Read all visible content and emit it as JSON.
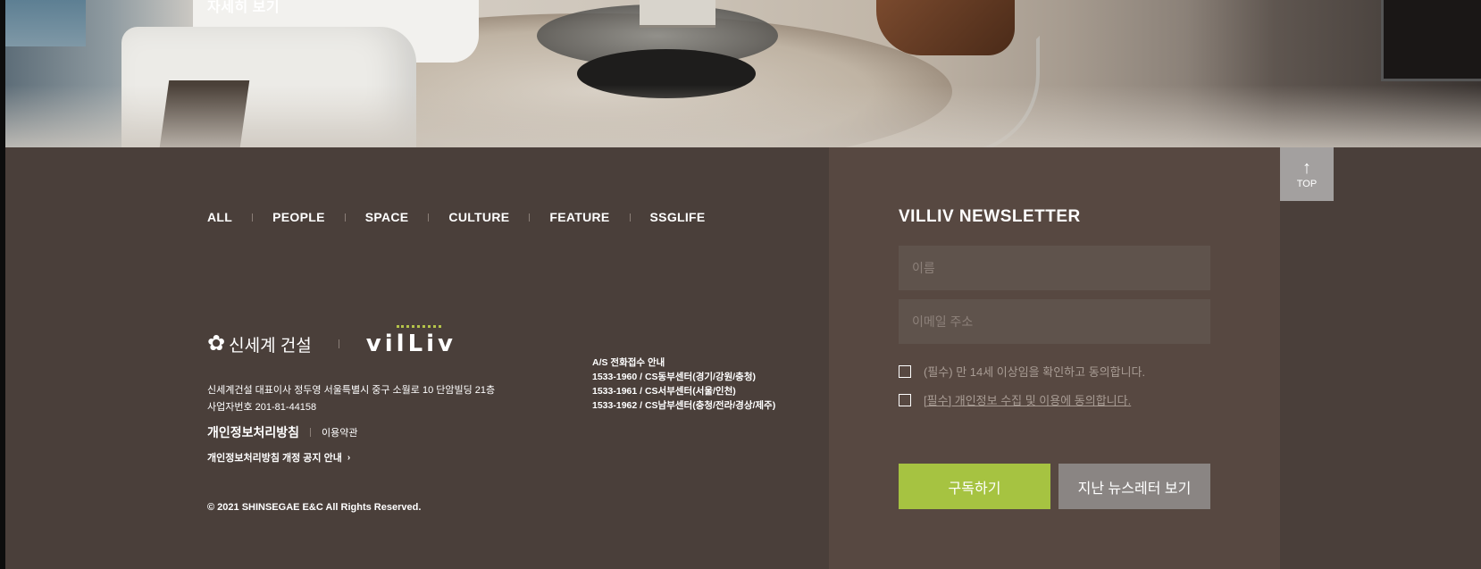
{
  "hero": {
    "link_text": "자세히 보기"
  },
  "nav": [
    "ALL",
    "PEOPLE",
    "SPACE",
    "CULTURE",
    "FEATURE",
    "SSGLIFE"
  ],
  "logos": {
    "ssg": "신세계 건설",
    "villiv": "vilLiv"
  },
  "company": {
    "address": "신세계건설 대표이사 정두영 서울특별시 중구 소월로 10 단암빌딩 21층",
    "biz_no": "사업자번호 201-81-44158"
  },
  "links": {
    "privacy": "개인정보처리방침",
    "terms": "이용약관",
    "notice": "개인정보처리방침 개정 공지 안내"
  },
  "copyright": "© 2021 SHINSEGAE E&C All Rights Reserved.",
  "as_info": {
    "title": "A/S 전화접수 안내",
    "lines": [
      "1533-1960 / CS동부센터(경기/강원/충청)",
      "1533-1961 / CS서부센터(서울/인천)",
      "1533-1962 / CS남부센터(충청/전라/경상/제주)"
    ]
  },
  "newsletter": {
    "title": "VILLIV NEWSLETTER",
    "name_placeholder": "이름",
    "email_placeholder": "이메일 주소",
    "agree_age": "(필수) 만 14세 이상임을 확인하고 동의합니다.",
    "agree_privacy": "[필수] 개인정보 수집 및 이용에 동의합니다.",
    "subscribe": "구독하기",
    "past": "지난 뉴스레터 보기"
  },
  "top_button": {
    "label": "TOP"
  },
  "colors": {
    "accent": "#a6c341",
    "footer_bg": "#4a3f3a",
    "newsletter_bg": "#574841"
  }
}
